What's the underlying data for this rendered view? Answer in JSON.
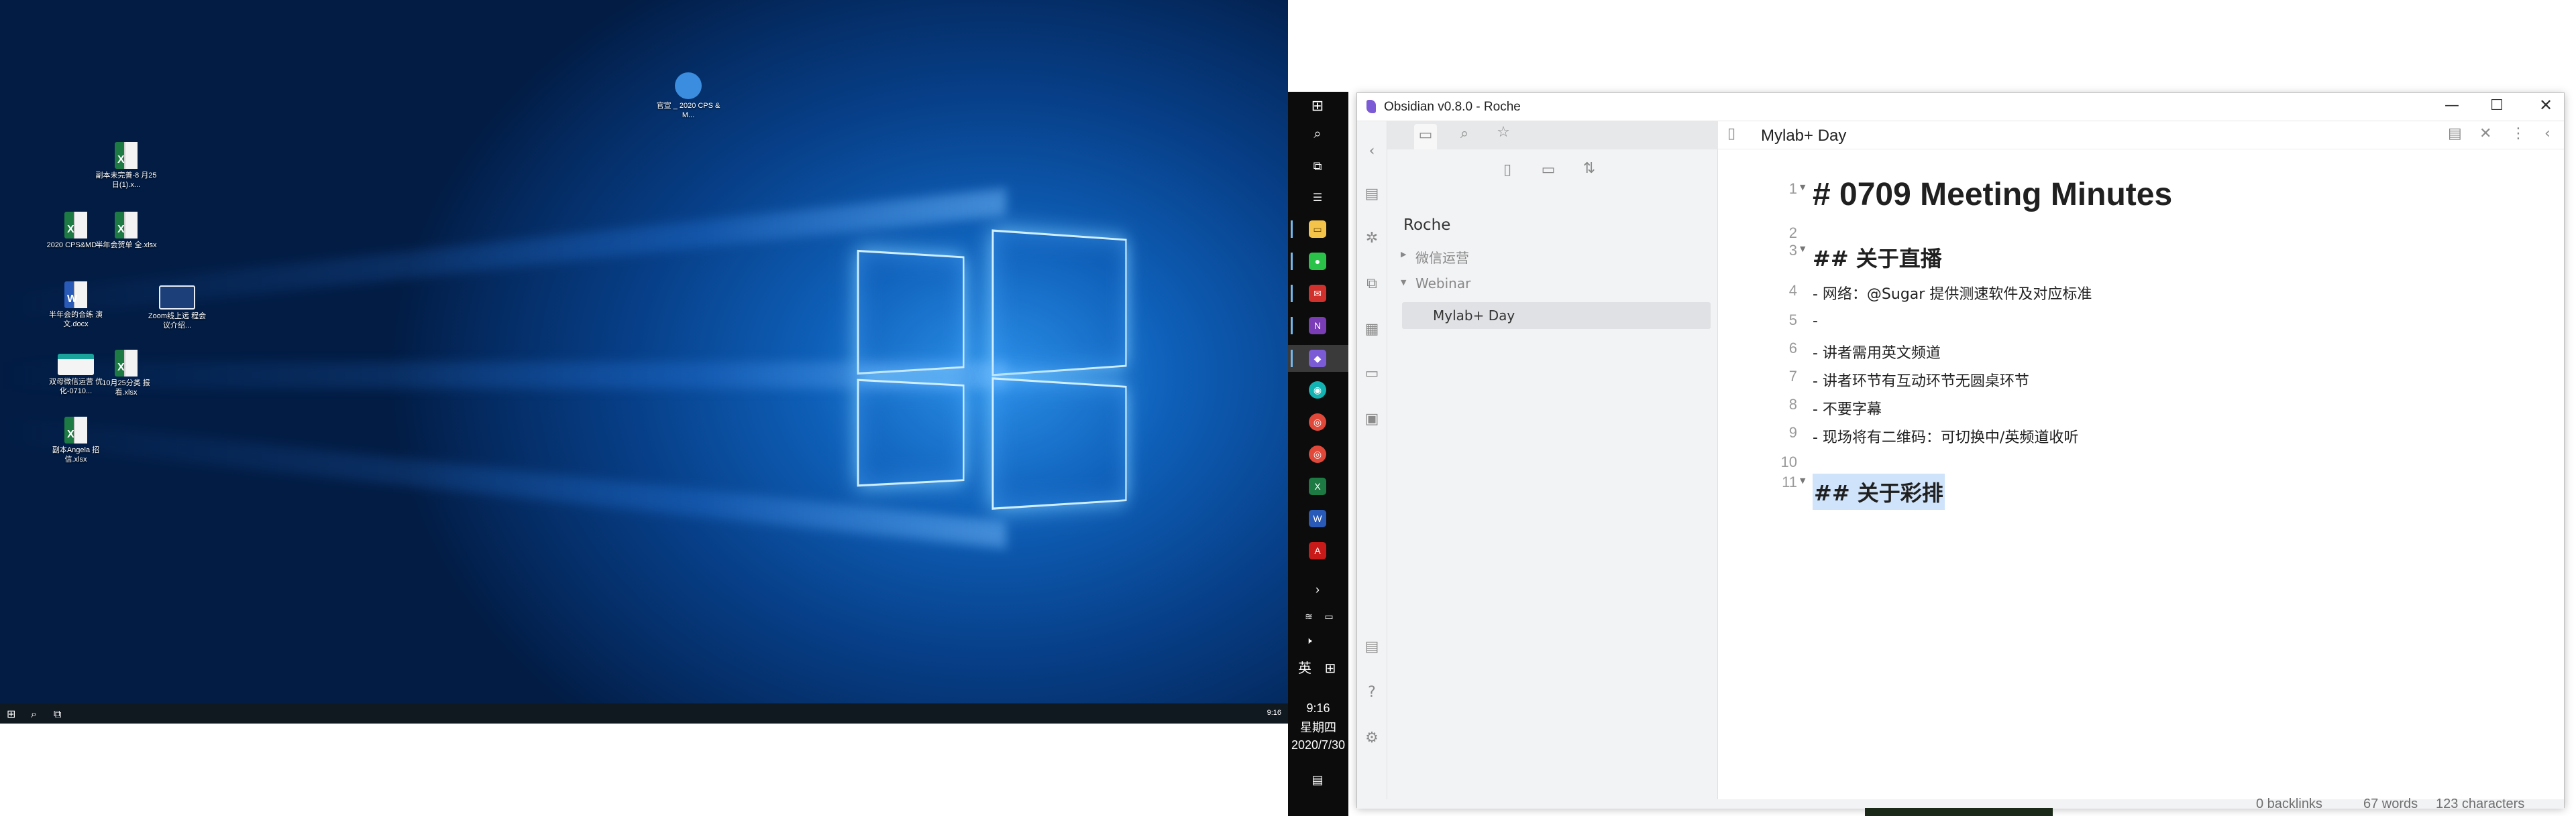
{
  "desktop": {
    "icons": [
      {
        "label": "官宣 _ 2020 CPS & M...",
        "icon": "folder-icon"
      },
      {
        "label": "副本未完善-8 月25日(1).x...",
        "icon": "excel-icon"
      },
      {
        "label": "2020 CPS&MD ...",
        "icon": "excel-icon"
      },
      {
        "label": "半年会贺单 全.xlsx",
        "icon": "excel-icon"
      },
      {
        "label": "半年会的合练 演文.docx",
        "icon": "word-icon"
      },
      {
        "label": "Zoom线上远 程会议介绍...",
        "icon": "image-icon"
      },
      {
        "label": "双母微信运营 优化-0710...",
        "icon": "image-icon"
      },
      {
        "label": "10月25分类 报看.xlsx",
        "icon": "excel-icon"
      },
      {
        "label": "副本Angela 招信.xlsx",
        "icon": "excel-icon"
      }
    ],
    "taskbar_time": "9:16"
  },
  "taskbar": {
    "time": "9:16",
    "weekday": "星期四",
    "date": "2020/7/30",
    "ime_lang": "英",
    "ime_mode": "⊞"
  },
  "window": {
    "title": "Obsidian v0.8.0 - Roche"
  },
  "sidebar": {
    "vault_name": "Roche",
    "folders": [
      {
        "label": "微信运营",
        "expanded": false
      },
      {
        "label": "Webinar",
        "expanded": true
      }
    ],
    "files": [
      {
        "label": "Mylab+ Day",
        "active": true
      }
    ]
  },
  "editor": {
    "tab_title": "Mylab+ Day",
    "lines": [
      {
        "n": "1",
        "text": "# 0709 Meeting Minutes",
        "kind": "h1",
        "fold": true
      },
      {
        "n": "2",
        "text": "",
        "kind": "blank",
        "fold": false
      },
      {
        "n": "3",
        "text": "## 关于直播",
        "kind": "h2",
        "fold": true
      },
      {
        "n": "4",
        "text": "- 网络：@Sugar 提供测速软件及对应标准",
        "kind": "li",
        "fold": false
      },
      {
        "n": "5",
        "text": "-",
        "kind": "li",
        "fold": false
      },
      {
        "n": "6",
        "text": "- 讲者需用英文频道",
        "kind": "li",
        "fold": false
      },
      {
        "n": "7",
        "text": "- 讲者环节有互动环节无圆桌环节",
        "kind": "li",
        "fold": false
      },
      {
        "n": "8",
        "text": "- 不要字幕",
        "kind": "li",
        "fold": false
      },
      {
        "n": "9",
        "text": "- 现场将有二维码：可切换中/英频道收听",
        "kind": "li",
        "fold": false
      },
      {
        "n": "10",
        "text": "",
        "kind": "blank",
        "fold": false
      },
      {
        "n": "11",
        "text": "## 关于彩排",
        "kind": "h2",
        "fold": true
      }
    ]
  },
  "statusbar": {
    "backlinks": "0 backlinks",
    "words": "67 words",
    "characters": "123 characters"
  },
  "colors": {
    "accent": "#7c5cd6",
    "selection": "#cfe3fa",
    "sidebar_bg": "#f2f3f5",
    "desktop_blue": "#0e5fb8"
  }
}
